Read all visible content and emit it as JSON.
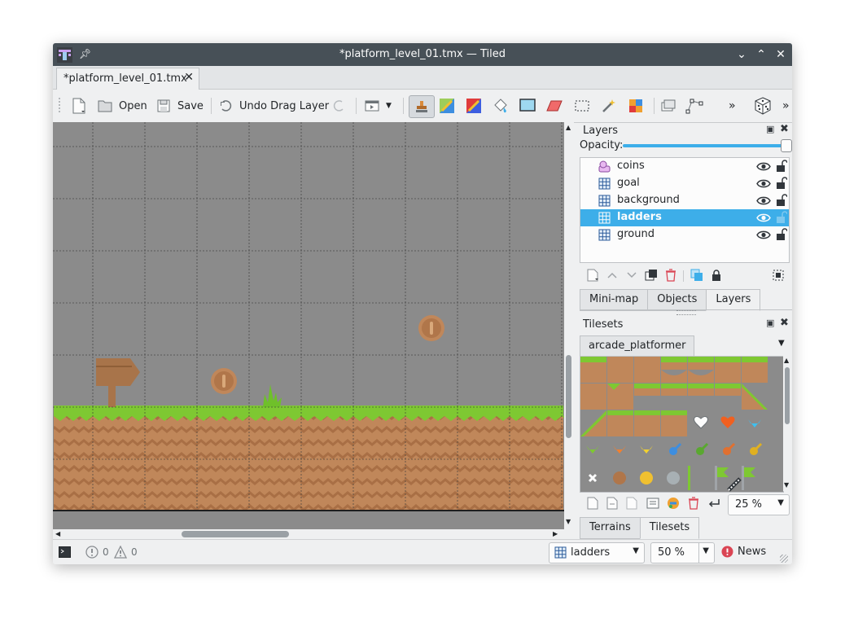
{
  "window": {
    "title": "*platform_level_01.tmx — Tiled",
    "controls": [
      "minimize",
      "maximize",
      "close"
    ]
  },
  "document_tab": {
    "label": "*platform_level_01.tmx"
  },
  "toolbar": {
    "open_label": "Open",
    "save_label": "Save",
    "undo_label": "Undo Drag Layer",
    "overflow_label": "»"
  },
  "layers_panel": {
    "title": "Layers",
    "opacity_label": "Opacity:",
    "opacity": 1.0,
    "layers": [
      {
        "name": "coins",
        "type": "object",
        "selected": false
      },
      {
        "name": "goal",
        "type": "tile",
        "selected": false
      },
      {
        "name": "background",
        "type": "tile",
        "selected": false
      },
      {
        "name": "ladders",
        "type": "tile",
        "selected": true
      },
      {
        "name": "ground",
        "type": "tile",
        "selected": false
      }
    ],
    "tabs": [
      "Mini-map",
      "Objects",
      "Layers"
    ],
    "active_tab": "Layers"
  },
  "tilesets_panel": {
    "title": "Tilesets",
    "tileset_tab": "arcade_platformer",
    "zoom": "25 %",
    "tabs": [
      "Terrains",
      "Tilesets"
    ],
    "active_tab": "Tilesets"
  },
  "statusbar": {
    "errors": "0",
    "warnings": "0",
    "current_layer": "ladders",
    "zoom": "50 %",
    "news_label": "News"
  },
  "colors": {
    "selection": "#3daee9",
    "canvas_bg": "#8b8b8b",
    "grass": "#7ec832",
    "dirt": "#c0875a",
    "titlebar": "#475057"
  }
}
